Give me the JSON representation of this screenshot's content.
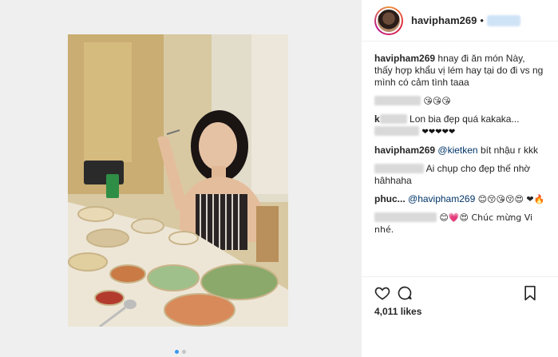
{
  "post": {
    "username": "havipham269",
    "header_separator": "•",
    "likes": "4,011 likes"
  },
  "carousel": {
    "count": 2,
    "active_index": 0
  },
  "comments": [
    {
      "user": "havipham269",
      "text": "hnay đi ăn món Này, thấy hợp khẩu vị lém hay tại do đi vs ng mình có cảm tình taaa"
    },
    {
      "user": "",
      "text": "😘😘😘"
    },
    {
      "user": "k",
      "text": "Lon bia đẹp quá kakaka..."
    },
    {
      "user": "",
      "text": "❤❤❤❤❤"
    },
    {
      "user": "havipham269",
      "mention": "@kietken",
      "text": "bít nhậu r kkk"
    },
    {
      "user": "",
      "text": "Ai chụp cho đẹp thế nhờ hâhhaha"
    },
    {
      "user": "phuc...",
      "mention": "@havipham269",
      "text": "😊😚😘😚😍 ❤🔥"
    },
    {
      "user": "",
      "text": "😊💗😍 Chúc mừng Vi nhé."
    }
  ],
  "colors": {
    "brand_gradient": [
      "#f09433",
      "#dc2743",
      "#bc1888"
    ],
    "mention": "#003569",
    "dot_active": "#3897f0"
  },
  "icons": [
    "heart-icon",
    "comment-icon",
    "bookmark-icon"
  ]
}
